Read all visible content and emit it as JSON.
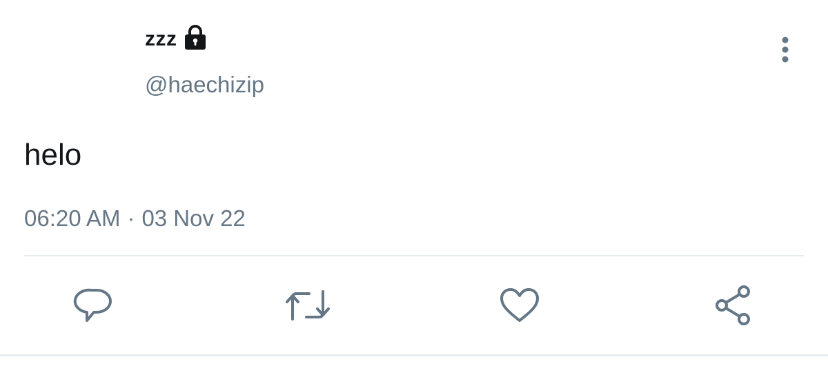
{
  "tweet": {
    "display_name": "zzz",
    "handle": "@haechizip",
    "text": "helo",
    "time": "06:20 AM",
    "separator": "·",
    "date": "03 Nov 22"
  },
  "icons": {
    "lock": "lock-icon",
    "more": "more-vertical-icon",
    "reply": "reply-icon",
    "retweet": "retweet-icon",
    "like": "like-icon",
    "share": "share-icon"
  },
  "colors": {
    "text_primary": "#14171a",
    "text_secondary": "#657786",
    "icon": "#657786",
    "divider": "#e6ecf0"
  }
}
